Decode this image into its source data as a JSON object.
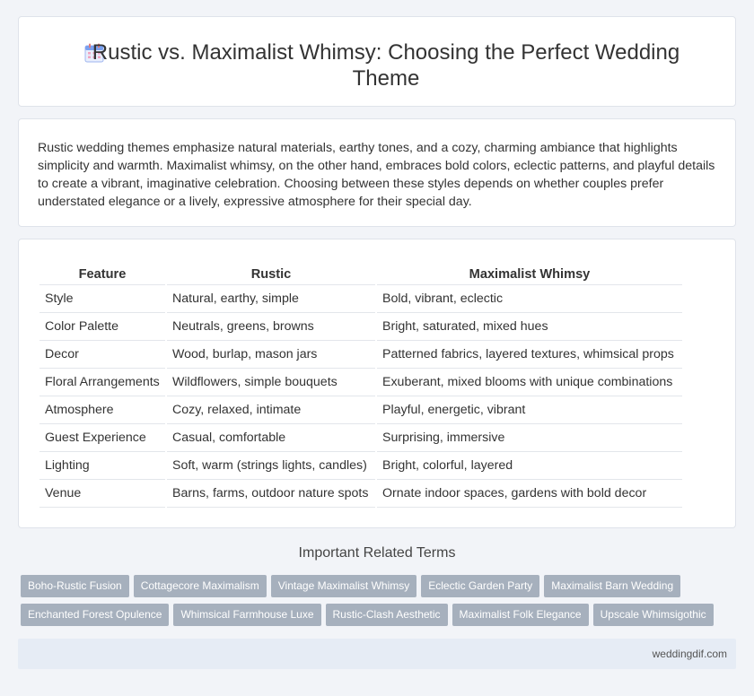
{
  "header": {
    "icon": "calendar-icon",
    "title": "Rustic vs. Maximalist Whimsy: Choosing the Perfect Wedding Theme"
  },
  "intro": {
    "text": "Rustic wedding themes emphasize natural materials, earthy tones, and a cozy, charming ambiance that highlights simplicity and warmth. Maximalist whimsy, on the other hand, embraces bold colors, eclectic patterns, and playful details to create a vibrant, imaginative celebration. Choosing between these styles depends on whether couples prefer understated elegance or a lively, expressive atmosphere for their special day."
  },
  "table": {
    "headers": [
      "Feature",
      "Rustic",
      "Maximalist Whimsy"
    ],
    "rows": [
      [
        "Style",
        "Natural, earthy, simple",
        "Bold, vibrant, eclectic"
      ],
      [
        "Color Palette",
        "Neutrals, greens, browns",
        "Bright, saturated, mixed hues"
      ],
      [
        "Decor",
        "Wood, burlap, mason jars",
        "Patterned fabrics, layered textures, whimsical props"
      ],
      [
        "Floral Arrangements",
        "Wildflowers, simple bouquets",
        "Exuberant, mixed blooms with unique combinations"
      ],
      [
        "Atmosphere",
        "Cozy, relaxed, intimate",
        "Playful, energetic, vibrant"
      ],
      [
        "Guest Experience",
        "Casual, comfortable",
        "Surprising, immersive"
      ],
      [
        "Lighting",
        "Soft, warm (strings lights, candles)",
        "Bright, colorful, layered"
      ],
      [
        "Venue",
        "Barns, farms, outdoor nature spots",
        "Ornate indoor spaces, gardens with bold decor"
      ]
    ]
  },
  "related": {
    "title": "Important Related Terms",
    "row1": [
      "Boho-Rustic Fusion",
      "Cottagecore Maximalism",
      "Vintage Maximalist Whimsy",
      "Eclectic Garden Party",
      "Maximalist Barn Wedding"
    ],
    "row2": [
      "Enchanted Forest Opulence",
      "Whimsical Farmhouse Luxe",
      "Rustic-Clash Aesthetic",
      "Maximalist Folk Elegance",
      "Upscale Whimsigothic"
    ]
  },
  "footer": {
    "site": "weddingdif.com"
  },
  "colors": {
    "tag_bg": "#a6b0bd",
    "page_bg": "#f2f4f8",
    "footer_bg": "#e6ecf5"
  }
}
